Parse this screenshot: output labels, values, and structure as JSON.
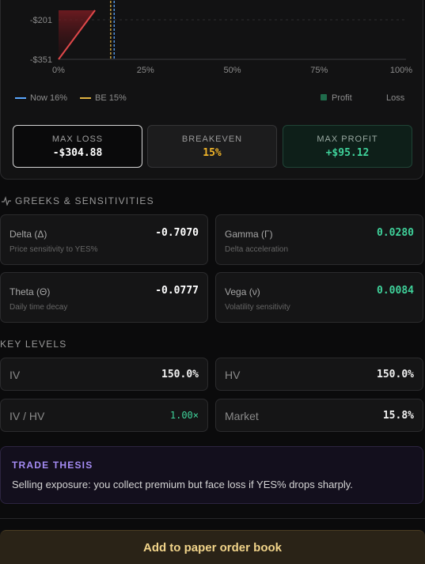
{
  "chart_data": {
    "type": "line",
    "x_ticks": [
      "0%",
      "25%",
      "50%",
      "75%",
      "100%"
    ],
    "y_ticks": [
      "-$201",
      "-$351"
    ],
    "xlim": [
      0,
      100
    ],
    "ylim": [
      -351,
      -201
    ],
    "series": [
      {
        "color": "#e0484a",
        "x": [
          0,
          10.5
        ],
        "y": [
          -351,
          -165
        ]
      }
    ],
    "markers": [
      {
        "name": "Now 16%",
        "x": 16,
        "color": "#5aa7ff"
      },
      {
        "name": "BE 15%",
        "x": 15,
        "color": "#e0b341"
      }
    ]
  },
  "legend": {
    "now": "Now 16%",
    "be": "BE 15%",
    "profit": "Profit",
    "loss": "Loss"
  },
  "stats": {
    "max_loss": {
      "label": "MAX LOSS",
      "value": "-$304.88"
    },
    "breakeven": {
      "label": "BREAKEVEN",
      "value": "15%"
    },
    "max_profit": {
      "label": "MAX PROFIT",
      "value": "+$95.12"
    }
  },
  "greeks": {
    "title": "GREEKS & SENSITIVITIES",
    "delta": {
      "name": "Delta (Δ)",
      "desc": "Price sensitivity to YES%",
      "value": "-0.7070"
    },
    "gamma": {
      "name": "Gamma (Γ)",
      "desc": "Delta acceleration",
      "value": "0.0280"
    },
    "theta": {
      "name": "Theta (Θ)",
      "desc": "Daily time decay",
      "value": "-0.0777"
    },
    "vega": {
      "name": "Vega (ν)",
      "desc": "Volatility sensitivity",
      "value": "0.0084"
    }
  },
  "key_levels": {
    "title": "KEY LEVELS",
    "iv": {
      "label": "IV",
      "value": "150.0%"
    },
    "hv": {
      "label": "HV",
      "value": "150.0%"
    },
    "iv_hv": {
      "label": "IV / HV",
      "value": "1.00×"
    },
    "market": {
      "label": "Market",
      "value": "15.8%"
    }
  },
  "thesis": {
    "title": "TRADE THESIS",
    "text": "Selling exposure: you collect premium but face loss if YES% drops sharply."
  },
  "cta": {
    "label": "Add to paper order book"
  },
  "colors": {
    "green": "#3fd19a",
    "orange": "#f0b429",
    "red": "#e0484a",
    "purple": "#a58cf5"
  }
}
